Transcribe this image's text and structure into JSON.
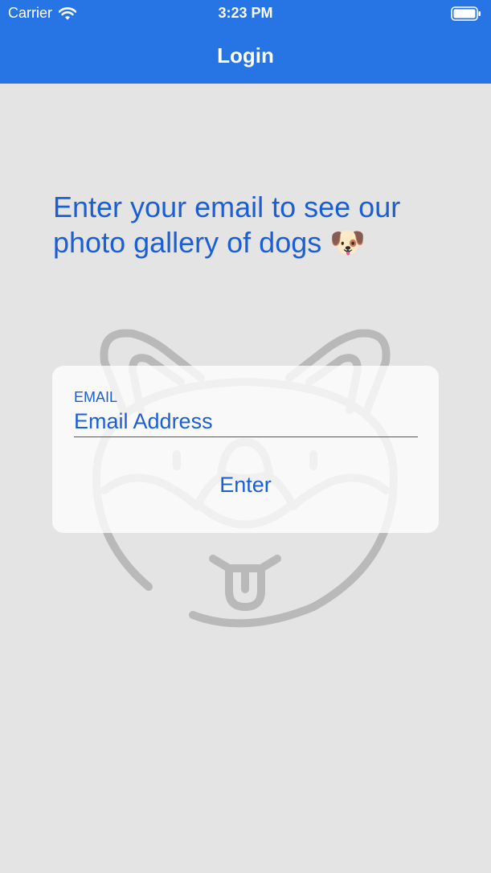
{
  "status_bar": {
    "carrier": "Carrier",
    "time": "3:23 PM",
    "wifi_icon": "wifi-icon",
    "battery_icon": "battery-icon"
  },
  "nav": {
    "title": "Login"
  },
  "main": {
    "headline": "Enter your email to see our photo gallery of dogs 🐶",
    "watermark_icon": "dog-face-icon"
  },
  "form": {
    "email_label": "EMAIL",
    "email_placeholder": "Email Address",
    "email_value": "",
    "enter_label": "Enter"
  },
  "colors": {
    "nav_background": "#2774e4",
    "accent": "#1a5fd6",
    "page_background": "#e4e4e4",
    "watermark": "#b9b9b9"
  }
}
